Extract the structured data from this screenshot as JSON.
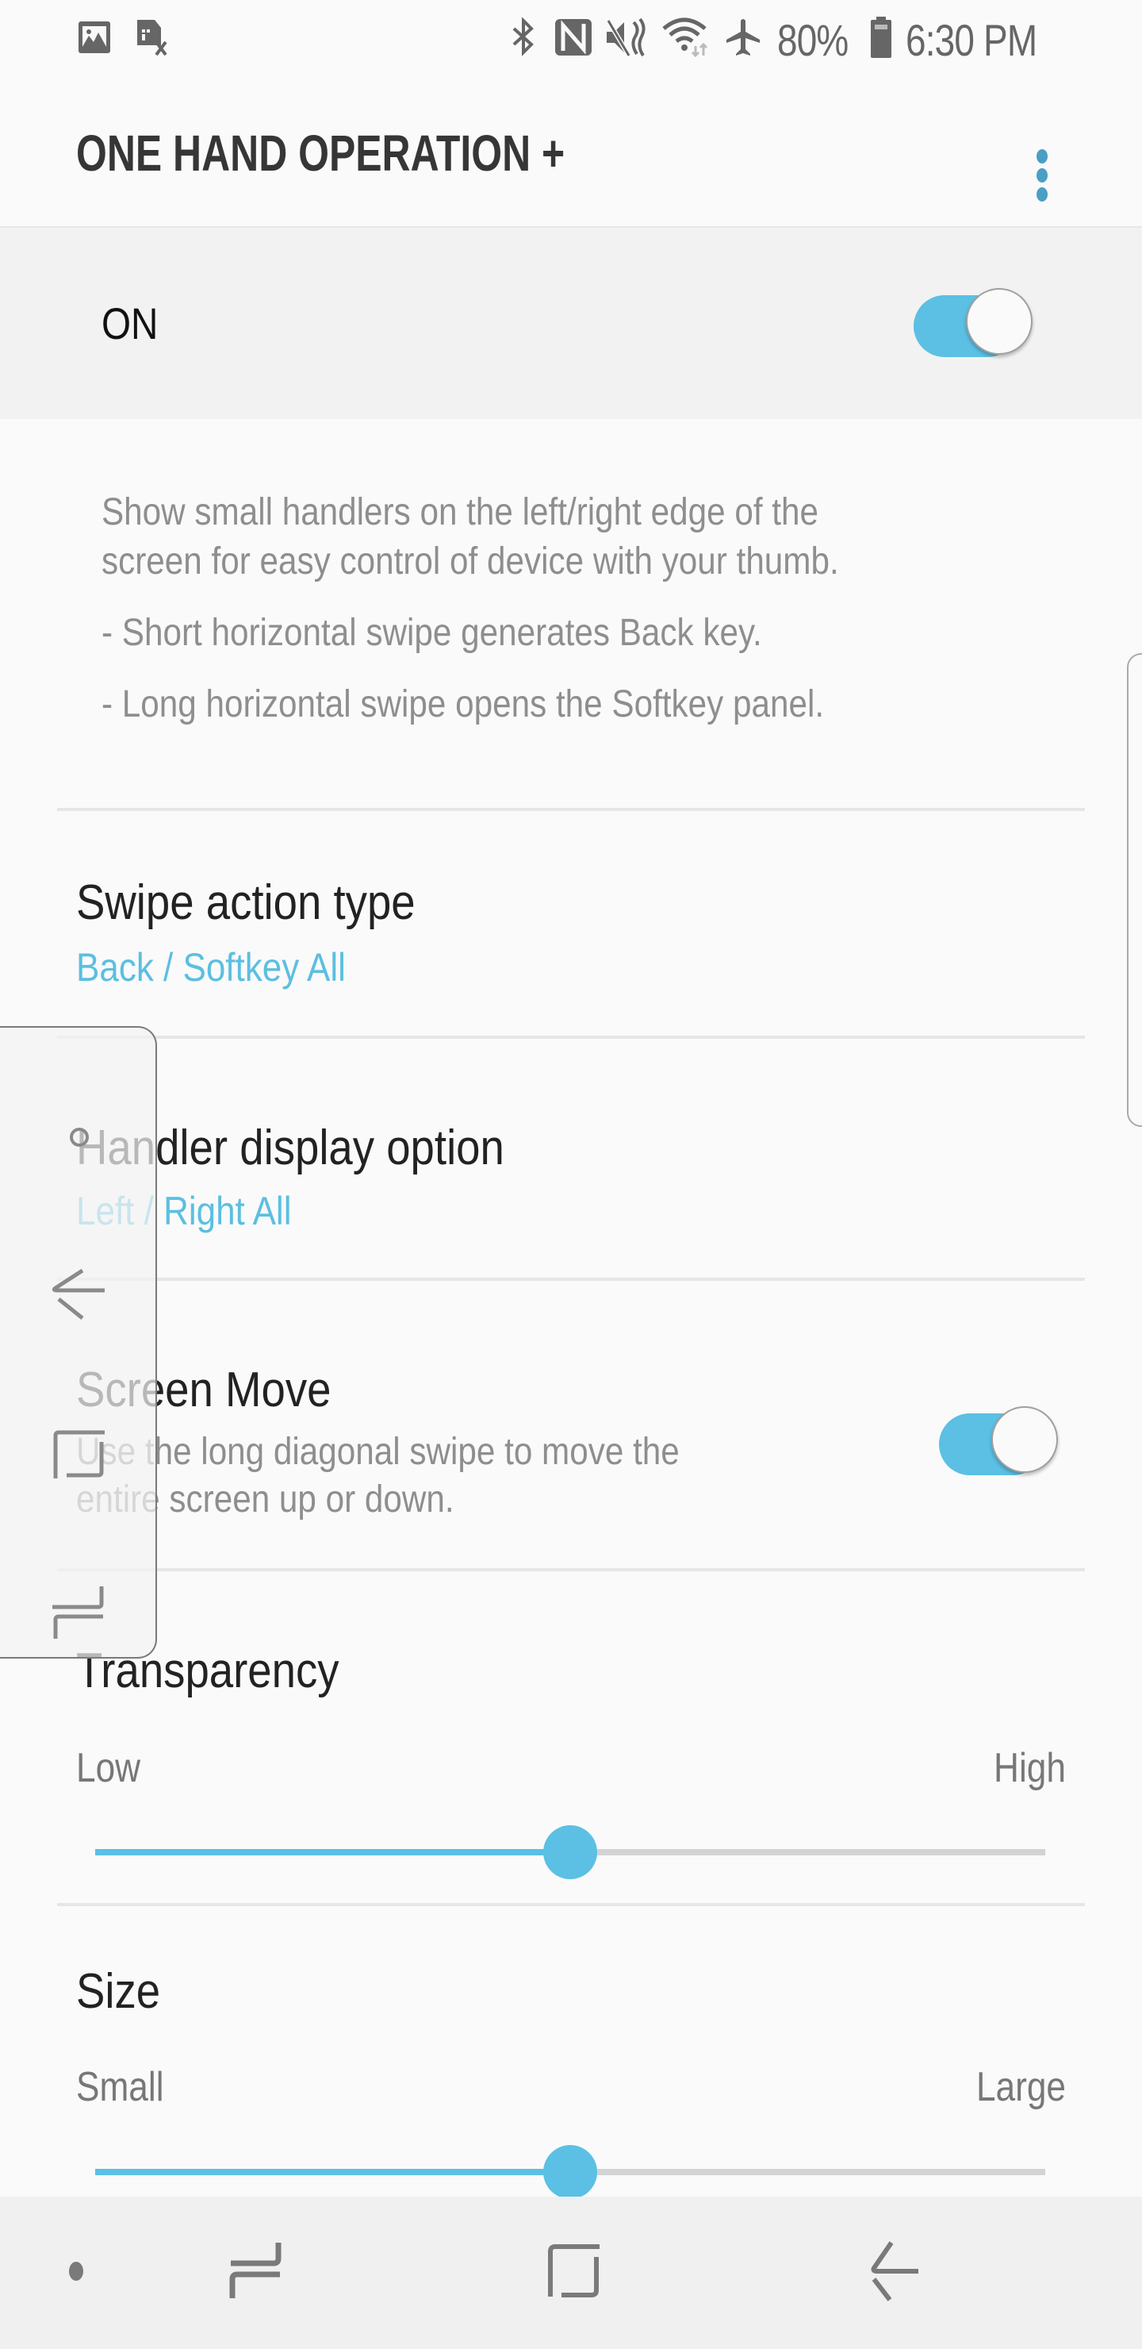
{
  "status_bar": {
    "left_icons": [
      "gallery-notification-icon",
      "sim-card-error-icon"
    ],
    "right_icons": [
      "bluetooth-icon",
      "nfc-icon",
      "mute-icon",
      "wifi-icon",
      "airplane-mode-icon"
    ],
    "battery_percent": "80%",
    "battery_icon": "battery-icon",
    "time": "6:30 PM"
  },
  "app_bar": {
    "title": "ONE HAND OPERATION +",
    "more_icon": "more-vert-icon"
  },
  "master_switch": {
    "label": "ON",
    "checked": true
  },
  "description": {
    "lines": [
      "Show small handlers on the left/right edge of the",
      "screen for easy control of device with your thumb.",
      "- Short horizontal swipe generates Back key.",
      "- Long horizontal swipe opens the Softkey panel."
    ]
  },
  "settings": {
    "swipe_action_type": {
      "title": "Swipe action type",
      "value": "Back / Softkey All"
    },
    "handler_display_option": {
      "title": "Handler display option",
      "value": "Left / Right All"
    },
    "screen_move": {
      "title": "Screen Move",
      "description_lines": [
        "Use the long diagonal swipe to move the",
        "entire screen up or down."
      ],
      "checked": true
    },
    "transparency": {
      "title": "Transparency",
      "min_label": "Low",
      "max_label": "High",
      "value_fraction": 0.5
    },
    "size": {
      "title": "Size",
      "min_label": "Small",
      "max_label": "Large",
      "value_fraction": 0.5
    }
  },
  "softkey_panel": {
    "buttons": [
      "home-dot-icon",
      "back-arrow-icon",
      "home-square-icon",
      "recents-icon"
    ]
  },
  "nav_bar": {
    "buttons": [
      "nav-dot-icon",
      "recents-icon",
      "home-icon",
      "back-icon"
    ]
  },
  "colors": {
    "accent": "#5bc0e4",
    "title_text": "#363636",
    "secondary_text": "#8e8e8e",
    "master_bar_bg": "#f2f2f2",
    "nav_bar_bg": "#f0f0f0"
  }
}
